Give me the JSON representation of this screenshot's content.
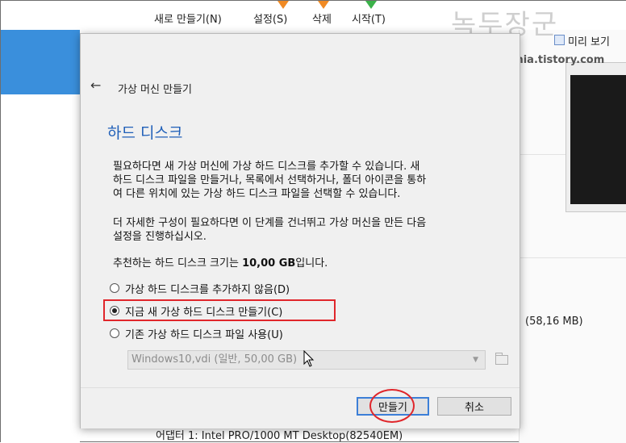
{
  "toolbar": {
    "new_label": "새로 만들기(N)",
    "settings_label": "설정(S)",
    "delete_label": "삭제",
    "start_label": "시작(T)"
  },
  "watermark": {
    "text": "녹두장군",
    "url": "http://mainia.tistory.com"
  },
  "preview": {
    "label": "미리 보기"
  },
  "background": {
    "size_text": "(58,16 MB)",
    "adapter_text": "어댑터 1:   Intel PRO/1000 MT Desktop(82540EM)"
  },
  "dialog": {
    "title": "가상 머신 만들기",
    "section_title": "하드 디스크",
    "para1_lines": [
      "필요하다면 새 가상 머신에 가상 하드 디스크를 추가할 수 있습니다. 새",
      "하드 디스크 파일을 만들거나, 목록에서 선택하거나, 폴더 아이콘을 통하",
      "여 다른 위치에 있는 가상 하드 디스크 파일을 선택할 수 있습니다."
    ],
    "para2_lines": [
      "더 자세한 구성이 필요하다면 이 단계를 건너뛰고 가상 머신을 만든 다음",
      "설정을 진행하십시오."
    ],
    "recommend_prefix": "추천하는 하드 디스크 크기는 ",
    "recommend_size": "10,00 GB",
    "recommend_suffix": "입니다.",
    "options": [
      {
        "label": "가상 하드 디스크를 추가하지 않음(D)",
        "selected": false
      },
      {
        "label": "지금 새 가상 하드 디스크 만들기(C)",
        "selected": true
      },
      {
        "label": "기존 가상 하드 디스크 파일 사용(U)",
        "selected": false
      }
    ],
    "existing_disk_value": "Windows10,vdi (일반, 50,00 GB)",
    "create_button": "만들기",
    "cancel_button": "취소"
  },
  "colors": {
    "accent_blue": "#1f5fb8",
    "highlight_red": "#e0262b",
    "primary_border": "#3c7fd7"
  }
}
